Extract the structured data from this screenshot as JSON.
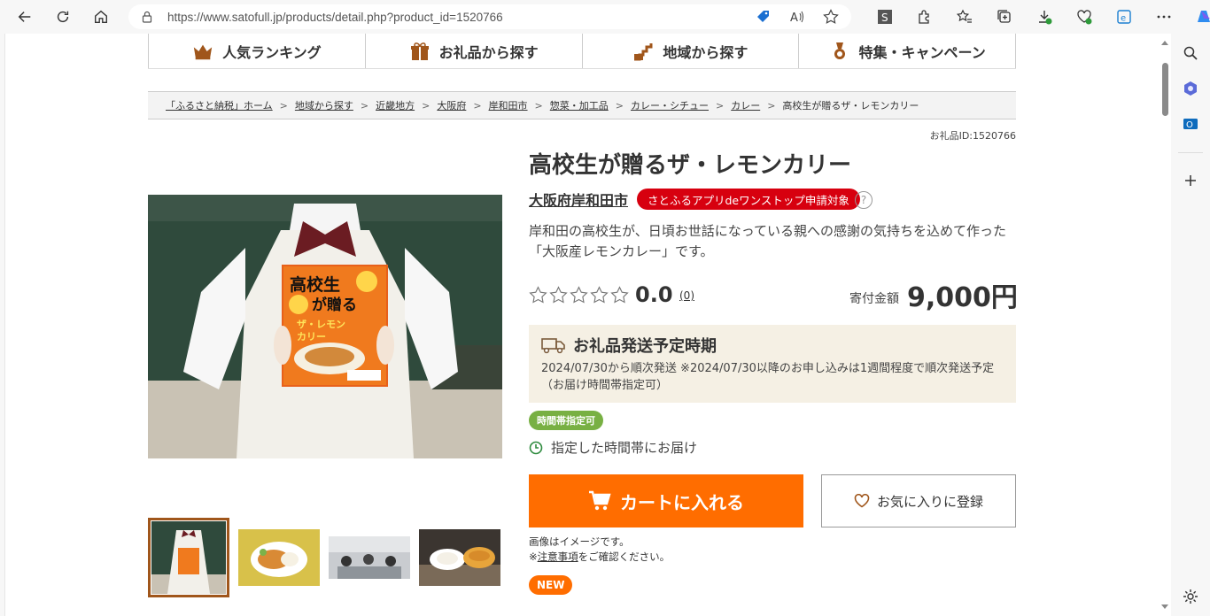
{
  "browser": {
    "url": "https://www.satofull.jp/products/detail.php?product_id=1520766"
  },
  "gnav": [
    {
      "label": "人気ランキング"
    },
    {
      "label": "お礼品から探す"
    },
    {
      "label": "地域から探す"
    },
    {
      "label": "特集・キャンペーン"
    }
  ],
  "breadcrumb": [
    "「ふるさと納税」ホーム",
    "地域から探す",
    "近畿地方",
    "大阪府",
    "岸和田市",
    "惣菜・加工品",
    "カレー・シチュー",
    "カレー",
    "高校生が贈るザ・レモンカリー"
  ],
  "product": {
    "id_label": "お礼品ID:1520766",
    "title": "高校生が贈るザ・レモンカリー",
    "city": "大阪府岸和田市",
    "app_badge": "さとふるアプリdeワンストップ申請対象",
    "help": "?",
    "description": "岸和田の高校生が、日頃お世話になっている親への感謝の気持ちを込めて作った「大阪産レモンカレー」です。",
    "rating": "0.0",
    "rating_count": "(0)",
    "price_label": "寄付金額",
    "price": "9,000円",
    "shipping_title": "お礼品発送予定時期",
    "shipping_text": "2024/07/30から順次発送 ※2024/07/30以降のお申し込みは1週間程度で順次発送予定 （お届け時間帯指定可）",
    "time_tag": "時間帯指定可",
    "delivery": "指定した時間帯にお届け",
    "cart_label": "カートに入れる",
    "fav_label": "お気に入りに登録",
    "note1": "画像はイメージです。",
    "note2_prefix": "※",
    "note2_link": "注意事項",
    "note2_suffix": "をご確認ください。",
    "new_badge": "NEW"
  },
  "colors": {
    "accent": "#ff6d00",
    "badge_red": "#d7000f",
    "tag_green": "#78b043",
    "ship_bg": "#f5f0e4"
  }
}
